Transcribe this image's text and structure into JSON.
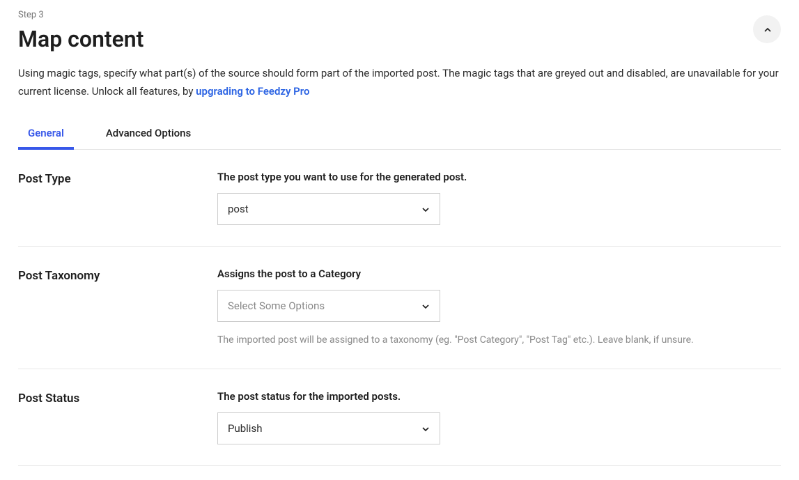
{
  "step": "Step 3",
  "title": "Map content",
  "description_prefix": "Using magic tags, specify what part(s) of the source should form part of the imported post. The magic tags that are greyed out and disabled, are unavailable for your current license. Unlock all features, by ",
  "description_link": "upgrading to Feedzy Pro",
  "tabs": {
    "general": "General",
    "advanced": "Advanced Options"
  },
  "rows": {
    "post_type": {
      "label": "Post Type",
      "field_label": "The post type you want to use for the generated post.",
      "value": "post"
    },
    "post_taxonomy": {
      "label": "Post Taxonomy",
      "field_label": "Assigns the post to a Category",
      "placeholder": "Select Some Options",
      "help": "The imported post will be assigned to a taxonomy (eg. \"Post Category\", \"Post Tag\" etc.). Leave blank, if unsure."
    },
    "post_status": {
      "label": "Post Status",
      "field_label": "The post status for the imported posts.",
      "value": "Publish"
    }
  }
}
